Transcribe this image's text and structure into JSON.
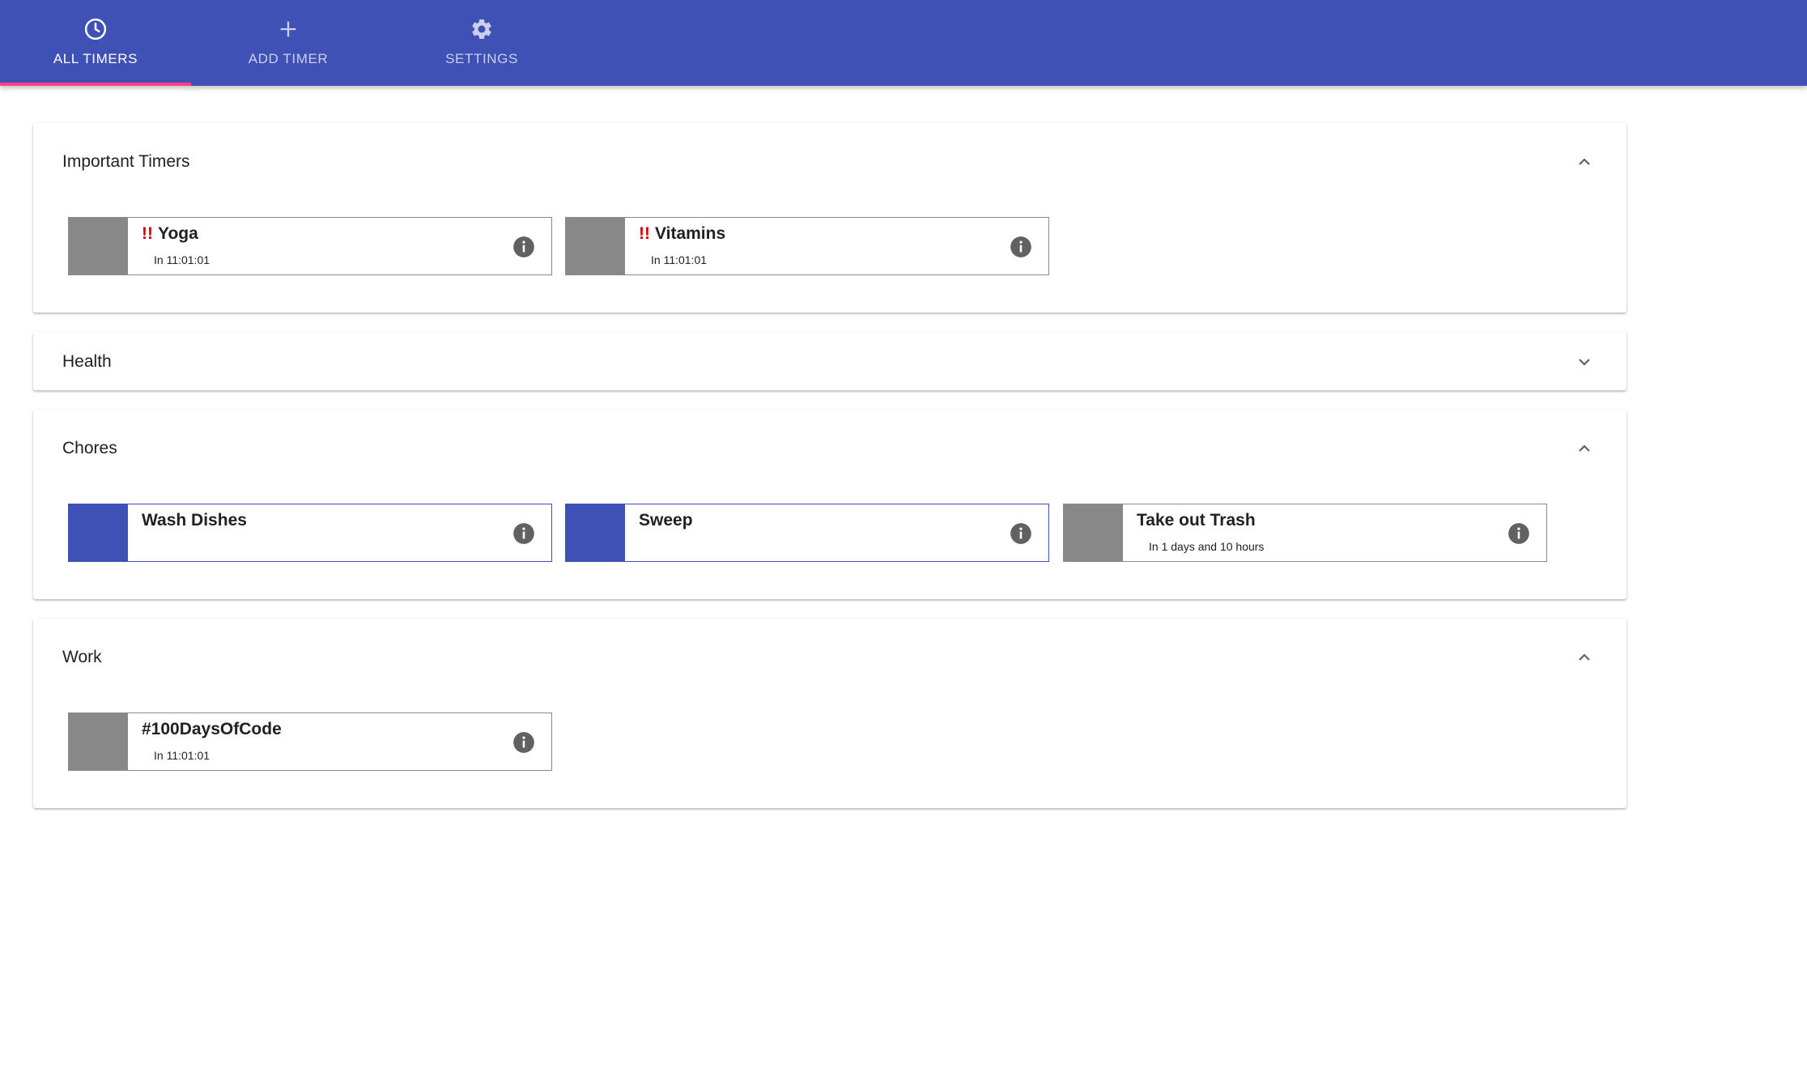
{
  "tabs": [
    {
      "label": "ALL TIMERS",
      "icon": "clock-icon",
      "active": true
    },
    {
      "label": "ADD TIMER",
      "icon": "plus-icon",
      "active": false
    },
    {
      "label": "SETTINGS",
      "icon": "gear-icon",
      "active": false
    }
  ],
  "colors": {
    "primary": "#3f51b5",
    "accent": "#ff4081",
    "inactive_timer": "#888888",
    "important": "#d50000"
  },
  "groups": [
    {
      "title": "Important Timers",
      "expanded": true,
      "timers": [
        {
          "important_mark": "!!",
          "name": "Yoga",
          "status": "In 11:01:01",
          "color": "#888888"
        },
        {
          "important_mark": "!!",
          "name": "Vitamins",
          "status": "In 11:01:01",
          "color": "#888888"
        }
      ]
    },
    {
      "title": "Health",
      "expanded": false,
      "timers": []
    },
    {
      "title": "Chores",
      "expanded": true,
      "timers": [
        {
          "name": "Wash Dishes",
          "status": "",
          "color": "#3f51b5"
        },
        {
          "name": "Sweep",
          "status": "",
          "color": "#3f51b5"
        },
        {
          "name": "Take out Trash",
          "status": "In 1 days and 10 hours",
          "color": "#888888"
        }
      ]
    },
    {
      "title": "Work",
      "expanded": true,
      "timers": [
        {
          "name": "#100DaysOfCode",
          "status": "In 11:01:01",
          "color": "#888888"
        }
      ]
    }
  ]
}
